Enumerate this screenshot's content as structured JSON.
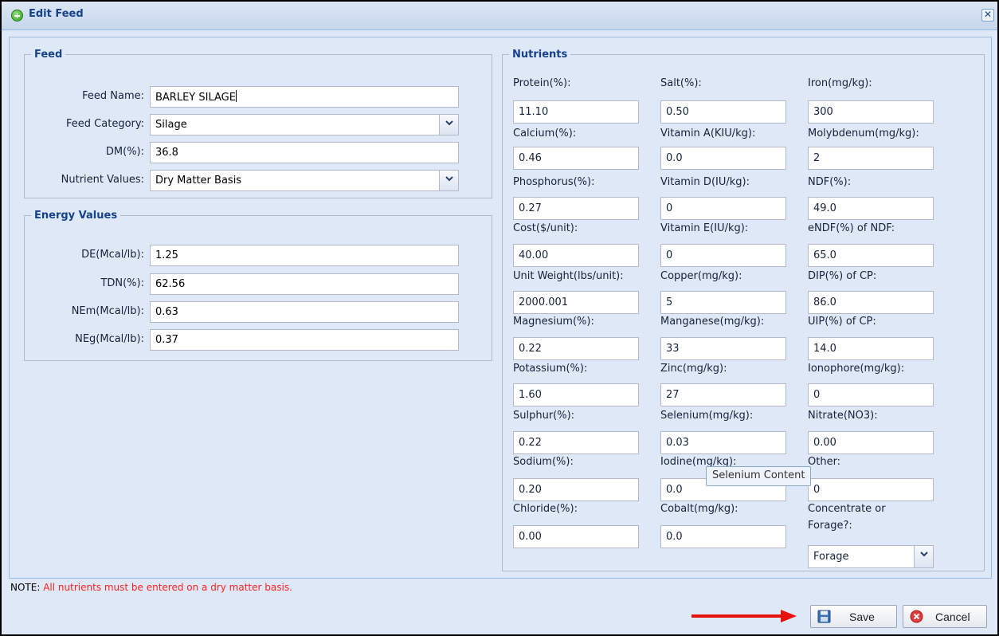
{
  "window": {
    "title": "Edit Feed",
    "close_glyph": "✕"
  },
  "feed": {
    "legend": "Feed",
    "fields": [
      {
        "label": "Feed Name:",
        "value": "BARLEY SILAGE"
      },
      {
        "label": "Feed Category:",
        "value": "Silage"
      },
      {
        "label": "DM(%):",
        "value": "36.8"
      },
      {
        "label": "Nutrient Values:",
        "value": "Dry Matter Basis"
      }
    ]
  },
  "energy": {
    "legend": "Energy Values",
    "fields": [
      {
        "label": "DE(Mcal/lb):",
        "value": "1.25"
      },
      {
        "label": "TDN(%):",
        "value": "62.56"
      },
      {
        "label": "NEm(Mcal/lb):",
        "value": "0.63"
      },
      {
        "label": "NEg(Mcal/lb):",
        "value": "0.37"
      }
    ]
  },
  "nutrients": {
    "legend": "Nutrients",
    "col1": [
      {
        "label": "Protein(%):",
        "value": "11.10"
      },
      {
        "label": "Calcium(%):",
        "value": "0.46"
      },
      {
        "label": "Phosphorus(%):",
        "value": "0.27"
      },
      {
        "label": "Cost($/unit):",
        "value": "40.00"
      },
      {
        "label": "Unit Weight(lbs/unit):",
        "value": "2000.001"
      },
      {
        "label": "Magnesium(%):",
        "value": "0.22"
      },
      {
        "label": "Potassium(%):",
        "value": "1.60"
      },
      {
        "label": "Sulphur(%):",
        "value": "0.22"
      },
      {
        "label": "Sodium(%):",
        "value": "0.20"
      },
      {
        "label": "Chloride(%):",
        "value": "0.00"
      }
    ],
    "col2": [
      {
        "label": "Salt(%):",
        "value": "0.50"
      },
      {
        "label": "Vitamin A(KIU/kg):",
        "value": "0.0"
      },
      {
        "label": "Vitamin D(IU/kg):",
        "value": "0"
      },
      {
        "label": "Vitamin E(IU/kg):",
        "value": "0"
      },
      {
        "label": "Copper(mg/kg):",
        "value": "5"
      },
      {
        "label": "Manganese(mg/kg):",
        "value": "33"
      },
      {
        "label": "Zinc(mg/kg):",
        "value": "27"
      },
      {
        "label": "Selenium(mg/kg):",
        "value": "0.03"
      },
      {
        "label": "Iodine(mg/kg):",
        "value": "0.0"
      },
      {
        "label": "Cobalt(mg/kg):",
        "value": "0.0"
      }
    ],
    "col3": [
      {
        "label": "Iron(mg/kg):",
        "value": "300"
      },
      {
        "label": "Molybdenum(mg/kg):",
        "value": "2"
      },
      {
        "label": "NDF(%):",
        "value": "49.0"
      },
      {
        "label": "eNDF(%) of NDF:",
        "value": "65.0"
      },
      {
        "label": "DIP(%) of CP:",
        "value": "86.0"
      },
      {
        "label": "UIP(%) of CP:",
        "value": "14.0"
      },
      {
        "label": "Ionophore(mg/kg):",
        "value": "0"
      },
      {
        "label": "Nitrate(NO3):",
        "value": "0.00"
      },
      {
        "label": "Other:",
        "value": "0"
      }
    ],
    "concentrate": {
      "label_line1": "Concentrate or",
      "label_line2": "Forage?:",
      "value": "Forage"
    }
  },
  "tooltip": "Selenium Content",
  "note": {
    "prefix": "NOTE:",
    "message": " All nutrients must be entered on a dry matter basis."
  },
  "buttons": {
    "save": "Save",
    "cancel": "Cancel"
  },
  "colors": {
    "title": "#15428b",
    "panel_bg": "#dfe8f6",
    "note_red": "#ff2222",
    "arrow_red": "#e8120c"
  },
  "icons": {
    "title": "add-circle-icon",
    "save": "floppy-disk-icon",
    "cancel": "cancel-circle-icon",
    "dropdown": "chevron-down-icon"
  }
}
